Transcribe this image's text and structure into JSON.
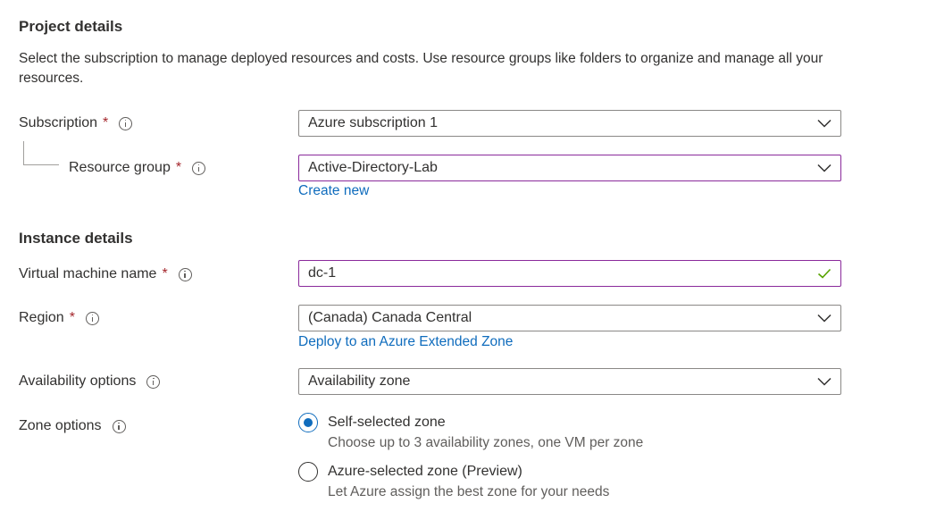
{
  "project_details": {
    "title": "Project details",
    "description": "Select the subscription to manage deployed resources and costs. Use resource groups like folders to organize and manage all your resources."
  },
  "subscription": {
    "label": "Subscription",
    "required_mark": "*",
    "value": "Azure subscription 1"
  },
  "resource_group": {
    "label": "Resource group",
    "required_mark": "*",
    "value": "Active-Directory-Lab",
    "create_new_link": "Create new"
  },
  "instance_details": {
    "title": "Instance details"
  },
  "vm_name": {
    "label": "Virtual machine name",
    "required_mark": "*",
    "value": "dc-1"
  },
  "region": {
    "label": "Region",
    "required_mark": "*",
    "value": "(Canada) Canada Central",
    "extended_zone_link": "Deploy to an Azure Extended Zone"
  },
  "availability_options": {
    "label": "Availability options",
    "value": "Availability zone"
  },
  "zone_options": {
    "label": "Zone options",
    "options": [
      {
        "label": "Self-selected zone",
        "description": "Choose up to 3 availability zones, one VM per zone",
        "selected": true
      },
      {
        "label": "Azure-selected zone (Preview)",
        "description": "Let Azure assign the best zone for your needs",
        "selected": false
      }
    ]
  },
  "icons": {
    "info": "info-icon",
    "dropdown": "chevron-down-icon",
    "valid": "checkmark-icon"
  },
  "colors": {
    "link": "#0f6cbd",
    "required": "#a4262c",
    "active_border": "#8a2a9b",
    "valid_check": "#57a300",
    "radio_selected": "#0f6cbd"
  }
}
